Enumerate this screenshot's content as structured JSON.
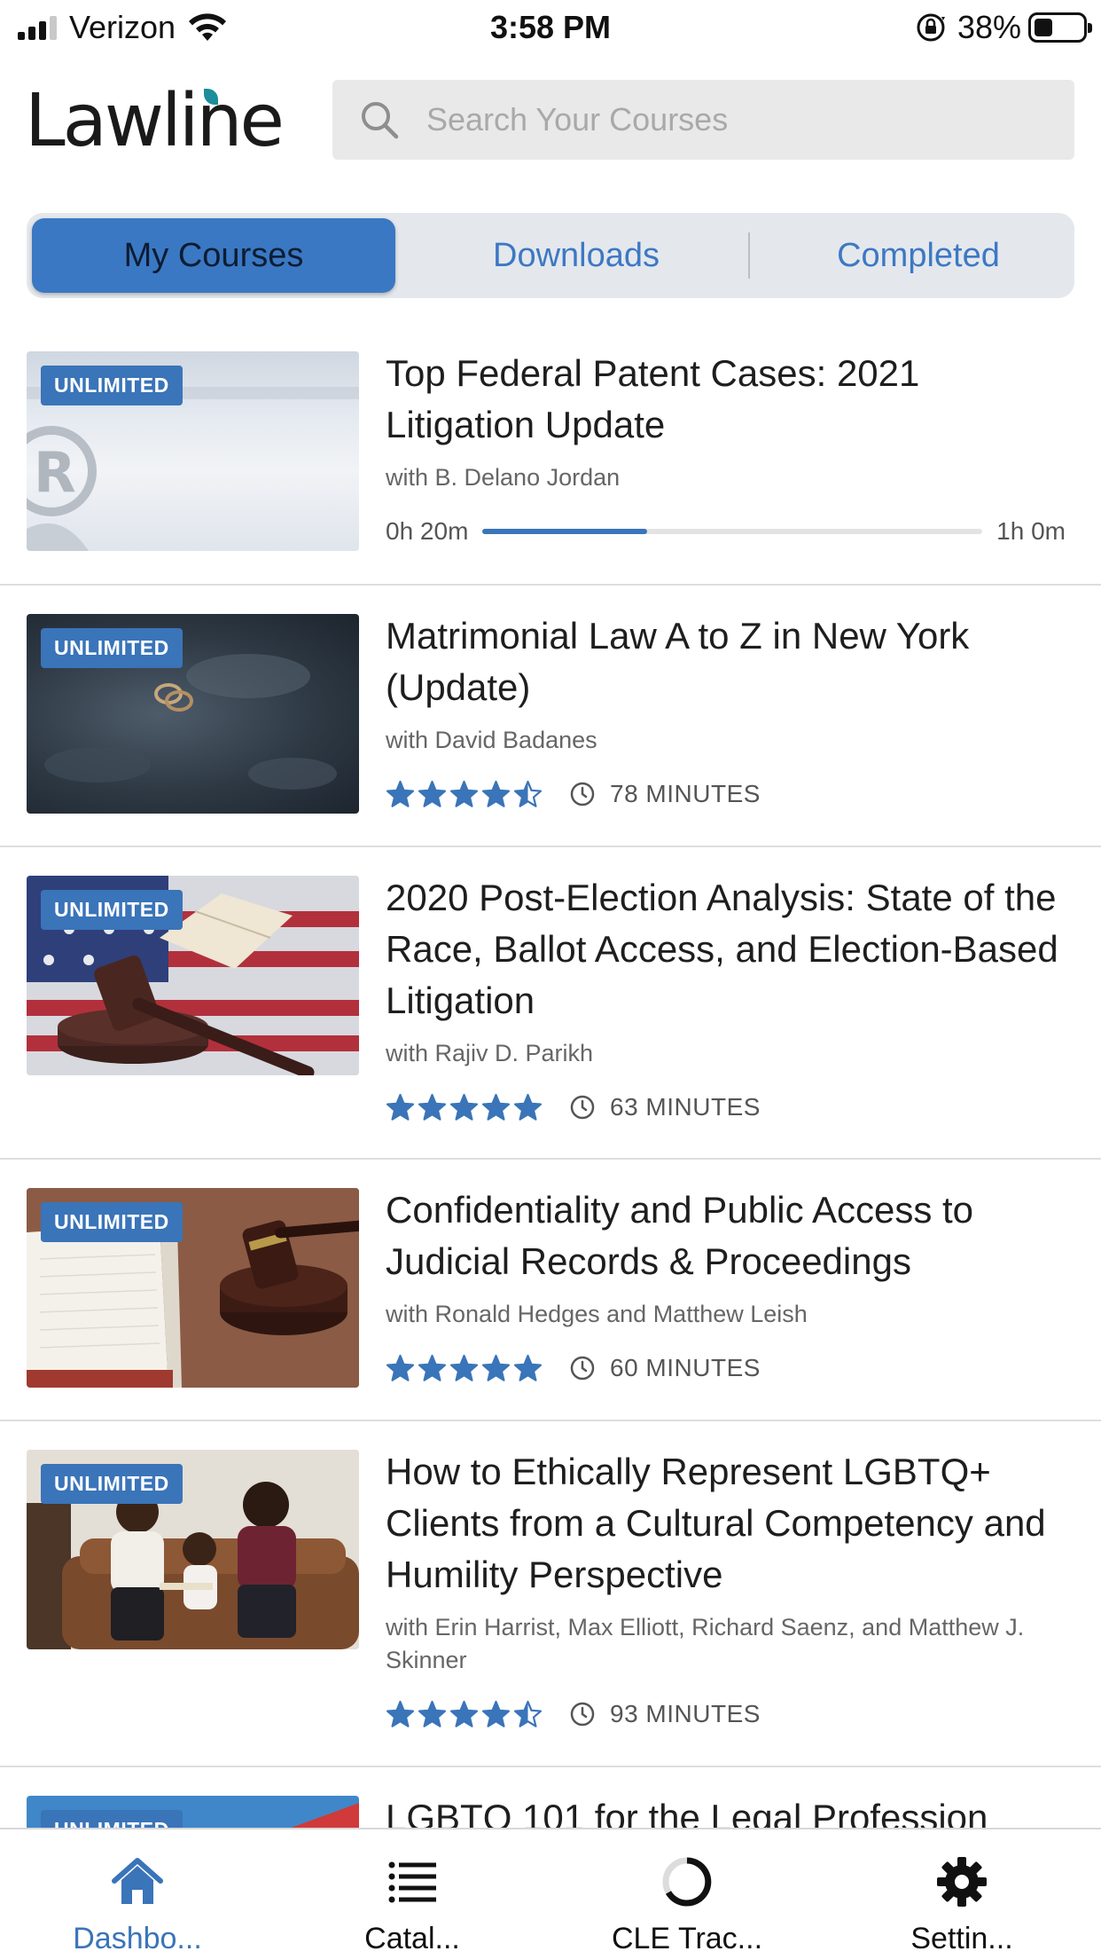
{
  "status_bar": {
    "carrier": "Verizon",
    "time": "3:58 PM",
    "battery": "38%",
    "battery_level": 0.38
  },
  "header": {
    "logo_text": "Lawline",
    "search_placeholder": "Search Your Courses"
  },
  "tabs": [
    {
      "label": "My Courses",
      "active": true
    },
    {
      "label": "Downloads",
      "active": false
    },
    {
      "label": "Completed",
      "active": false
    }
  ],
  "badge_label": "UNLIMITED",
  "courses": [
    {
      "title": "Top Federal Patent Cases: 2021 Litigation Update",
      "author": "with B. Delano Jordan",
      "progress_start": "0h 20m",
      "progress_end": "1h 0m",
      "progress_fraction": 0.33
    },
    {
      "title": "Matrimonial Law A to Z in New York (Update)",
      "author": "with David Badanes",
      "rating": 4.5,
      "duration": "78 MINUTES"
    },
    {
      "title": "2020 Post-Election Analysis: State of the Race, Ballot Access, and Election-Based Litigation",
      "author": "with Rajiv D. Parikh",
      "rating": 5,
      "duration": "63 MINUTES"
    },
    {
      "title": "Confidentiality and Public Access to Judicial Records & Proceedings",
      "author": "with Ronald Hedges and Matthew Leish",
      "rating": 5,
      "duration": "60 MINUTES"
    },
    {
      "title": "How to Ethically Represent LGBTQ+ Clients from a Cultural Competency and Humility Perspective",
      "author": "with Erin Harrist, Max Elliott, Richard Saenz, and Matthew J. Skinner",
      "rating": 4.5,
      "duration": "93 MINUTES"
    },
    {
      "title": "LGBTQ 101 for the Legal Profession",
      "author": "",
      "rating": 0,
      "duration": ""
    }
  ],
  "bottom_nav": [
    {
      "label": "Dashbo...",
      "icon": "home-icon",
      "active": true
    },
    {
      "label": "Catal...",
      "icon": "list-icon",
      "active": false
    },
    {
      "label": "CLE Trac...",
      "icon": "progress-ring-icon",
      "active": false
    },
    {
      "label": "Settin...",
      "icon": "gear-icon",
      "active": false
    }
  ],
  "colors": {
    "accent": "#3a74b9",
    "star": "#3a74b9",
    "segment_active": "#3a78c3",
    "segment_bg": "#e4e8ed"
  }
}
